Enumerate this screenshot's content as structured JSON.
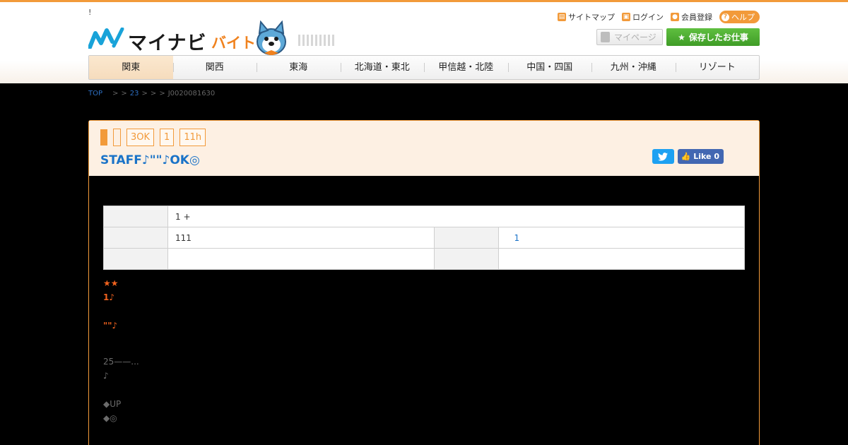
{
  "header": {
    "tagline": "!",
    "logo_text": "マイナビ",
    "logo_sub": "バイト",
    "top_links": [
      {
        "label": "サイトマップ",
        "icon": "sitemap-icon"
      },
      {
        "label": "ログイン",
        "icon": "lock-icon"
      },
      {
        "label": "会員登録",
        "icon": "member-icon"
      }
    ],
    "help_label": "ヘルプ",
    "mypage_label": "マイページ",
    "saved_jobs_label": "保存したお仕事",
    "accent_color": "#f29a3a",
    "green_color": "#4caf35"
  },
  "nav": [
    "関東",
    "関西",
    "東海",
    "北海道・東北",
    "甲信越・北陸",
    "中国・四国",
    "九州・沖縄",
    "リゾート"
  ],
  "breadcrumb": {
    "top": "TOP",
    "sep1": ">",
    "sep2": ">",
    "link23": "23",
    "sep3": ">",
    "sep4": ">",
    "sep5": ">",
    "job_id": "J0020081630"
  },
  "job": {
    "tags": [
      "3OK",
      "1",
      "11h"
    ],
    "title": "STAFF♪\"\"♪OK◎",
    "like_label": "Like 0"
  },
  "info_table": {
    "row1_value": "1 +",
    "row2_value": "111",
    "row2_value2": "1"
  },
  "description": {
    "line1": "★★",
    "line2": "1♪",
    "line3": "\"\"♪",
    "line4": "25——...",
    "line5": "♪",
    "line6": "◆UP",
    "line7": "◆◎"
  }
}
